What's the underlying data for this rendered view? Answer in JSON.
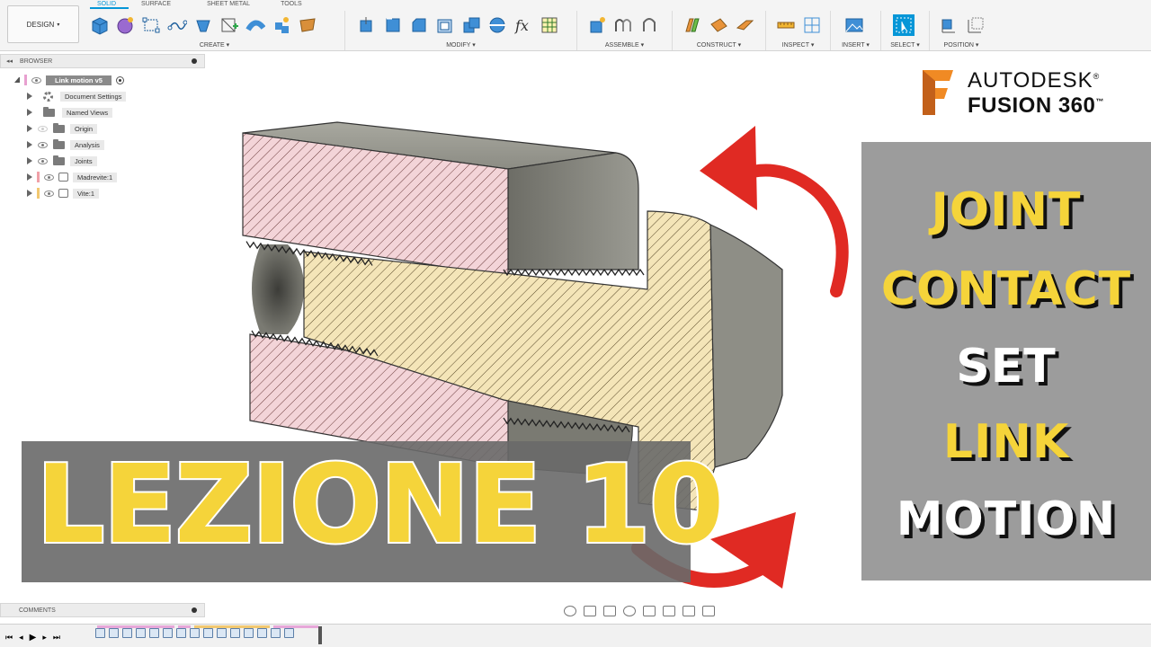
{
  "toolbar": {
    "workspace": "DESIGN",
    "tabs": [
      "SOLID",
      "SURFACE",
      "SHEET METAL",
      "TOOLS"
    ],
    "groups": [
      {
        "label": "CREATE ▾"
      },
      {
        "label": "MODIFY ▾"
      },
      {
        "label": "ASSEMBLE ▾"
      },
      {
        "label": "CONSTRUCT ▾"
      },
      {
        "label": "INSPECT ▾"
      },
      {
        "label": "INSERT ▾"
      },
      {
        "label": "SELECT ▾"
      },
      {
        "label": "POSITION ▾"
      }
    ]
  },
  "browser": {
    "title": "BROWSER",
    "root": "Link motion v5",
    "items": [
      {
        "label": "Document Settings",
        "icon": "gear-icon"
      },
      {
        "label": "Named Views",
        "icon": "folder-icon"
      },
      {
        "label": "Origin",
        "icon": "folder-icon"
      },
      {
        "label": "Analysis",
        "icon": "folder-icon"
      },
      {
        "label": "Joints",
        "icon": "folder-icon"
      },
      {
        "label": "Madrevite:1",
        "icon": "component-icon"
      },
      {
        "label": "Vite:1",
        "icon": "component-icon"
      }
    ]
  },
  "comments": {
    "title": "COMMENTS"
  },
  "logo": {
    "line1": "AUTODESK",
    "line2": "FUSION 360",
    "reg": "®",
    "tm": "™"
  },
  "topics": [
    "JOINT",
    "CONTACT",
    "SET",
    "LINK",
    "MOTION"
  ],
  "lesson": "LEZIONE 10",
  "colors": {
    "accent": "#0696d7",
    "yellow": "#f5d43a",
    "arrow_red": "#e02a23",
    "panel_grey": "#9c9c9c",
    "section_pink": "#f3d4d8",
    "section_yellow": "#f4e5b8"
  }
}
